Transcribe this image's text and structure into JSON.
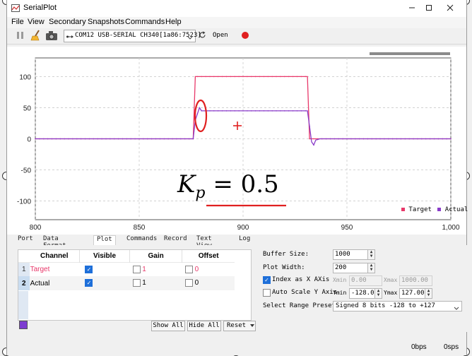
{
  "window": {
    "title": "SerialPlot"
  },
  "menu": [
    "File",
    "View",
    "Secondary",
    "Snapshots",
    "Commands",
    "Help"
  ],
  "toolbar": {
    "port": "COM12 USB-SERIAL CH340[1a86:7523]",
    "open_label": "Open"
  },
  "chart_data": {
    "type": "line",
    "xlim": [
      800,
      1000
    ],
    "ylim": [
      -130,
      130
    ],
    "x_ticks": [
      "800",
      "850",
      "900",
      "950",
      "1,000"
    ],
    "y_ticks": [
      "100",
      "50",
      "0",
      "-50",
      "-100"
    ],
    "series": [
      {
        "name": "Target",
        "color": "#e8386a",
        "points": [
          [
            800,
            0
          ],
          [
            876,
            0
          ],
          [
            877,
            100
          ],
          [
            931,
            100
          ],
          [
            932,
            0
          ],
          [
            1000,
            0
          ]
        ]
      },
      {
        "name": "Actual",
        "color": "#8a3cc9",
        "points": [
          [
            800,
            0
          ],
          [
            876,
            0
          ],
          [
            877,
            30
          ],
          [
            879,
            50
          ],
          [
            880,
            45
          ],
          [
            930,
            45
          ],
          [
            931,
            45
          ],
          [
            932,
            20
          ],
          [
            933,
            -5
          ],
          [
            934,
            -10
          ],
          [
            935,
            -2
          ],
          [
            937,
            0
          ],
          [
            1000,
            0
          ]
        ]
      }
    ],
    "legend_position": "bottom-right",
    "grid": true
  },
  "annotation": {
    "formula_main": "K",
    "formula_sub": "p",
    "formula_rest": "= 0.5"
  },
  "tabs": [
    "Port",
    "Data Format",
    "Plot",
    "Commands",
    "Record",
    "Text View",
    "Log"
  ],
  "channels": {
    "headers": [
      "Channel",
      "Visible",
      "Gain",
      "Offset"
    ],
    "rows": [
      {
        "num": "1",
        "name": "Target",
        "gain": "1",
        "offset": "0",
        "visible": true
      },
      {
        "num": "2",
        "name": "Actual",
        "gain": "1",
        "offset": "0",
        "visible": true
      }
    ],
    "show_all": "Show All",
    "hide_all": "Hide All",
    "reset": "Reset"
  },
  "settings": {
    "buffer_label": "Buffer Size:",
    "buffer_value": "1000",
    "width_label": "Plot Width:",
    "width_value": "200",
    "index_label": "Index as X AXis",
    "xmin_label": "Xmin",
    "xmin_value": "0.00",
    "xmax_label": "Xmax",
    "xmax_value": "1000.00",
    "autoscale_label": "Auto Scale Y Axis",
    "ymin_label": "Ymin",
    "ymin_value": "-128.00",
    "ymax_label": "Ymax",
    "ymax_value": "127.00",
    "preset_label": "Select Range Preset:",
    "preset_value": "Signed 8 bits -128 to +127"
  },
  "status": {
    "rx": "0bps",
    "sps": "0sps"
  }
}
